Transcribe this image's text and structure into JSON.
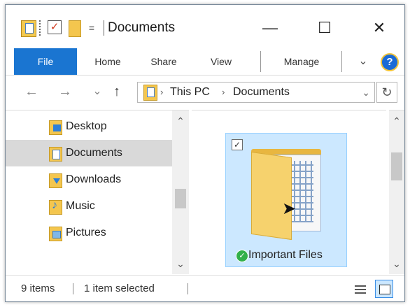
{
  "window": {
    "title": "Documents",
    "qa_menu_glyph": "=",
    "minimize_glyph": "—",
    "maximize_glyph": "☐",
    "close_glyph": "✕",
    "check_glyph": "✓"
  },
  "ribbon": {
    "tabs": [
      "File",
      "Home",
      "Share",
      "View",
      "Manage"
    ],
    "expand_glyph": "⌄",
    "help_glyph": "?"
  },
  "navbar": {
    "back_glyph": "←",
    "forward_glyph": "→",
    "recent_glyph": "⌄",
    "up_glyph": "↑",
    "crumb_sep": "›",
    "breadcrumb": [
      "This PC",
      "Documents"
    ],
    "dropdown_glyph": "⌄",
    "refresh_glyph": "↻"
  },
  "navpane": {
    "items": [
      {
        "label": "Desktop",
        "icon": "desktop-folder-icon"
      },
      {
        "label": "Documents",
        "icon": "documents-folder-icon",
        "selected": true
      },
      {
        "label": "Downloads",
        "icon": "downloads-folder-icon"
      },
      {
        "label": "Music",
        "icon": "music-folder-icon"
      },
      {
        "label": "Pictures",
        "icon": "pictures-folder-icon"
      }
    ],
    "scroll_up_glyph": "⌃",
    "scroll_down_glyph": "⌄"
  },
  "content": {
    "items": [
      {
        "label": "Important Files",
        "selected": true,
        "sync_status": "synced"
      }
    ],
    "checkbox_glyph": "✓",
    "cursor_glyph": "➤",
    "badge_glyph": "✓"
  },
  "statusbar": {
    "item_count": "9 items",
    "selection": "1 item selected"
  },
  "colors": {
    "accent": "#1a75d1",
    "selection": "#cce8ff",
    "folder": "#f4c64e"
  }
}
